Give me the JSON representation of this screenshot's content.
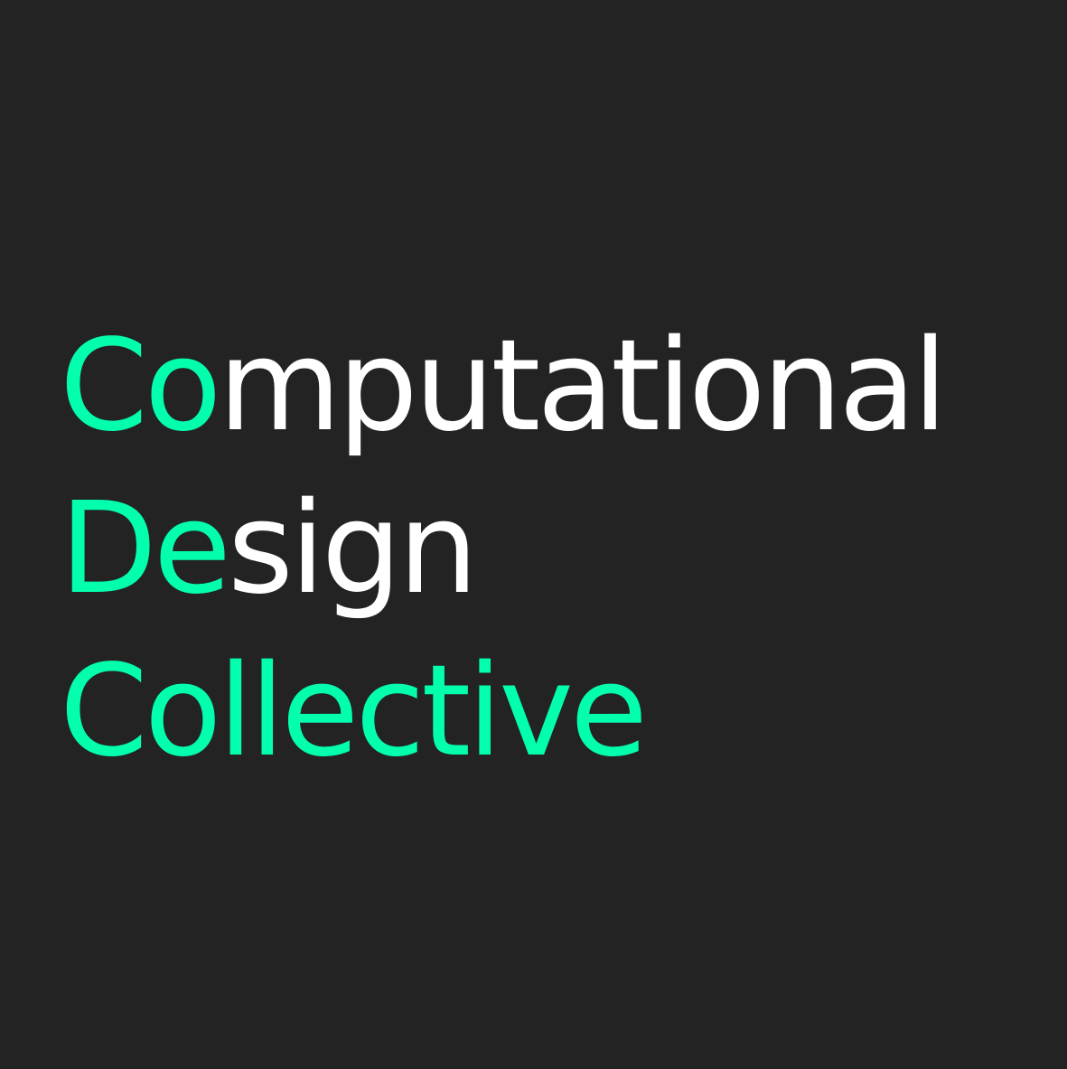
{
  "logo": {
    "lines": [
      {
        "highlight": "Co",
        "rest": "mputational"
      },
      {
        "highlight": "De",
        "rest": "sign"
      },
      {
        "highlight": "Collective",
        "rest": ""
      }
    ]
  },
  "colors": {
    "background": "#232323",
    "accent": "#03ffae",
    "text": "#ffffff"
  }
}
